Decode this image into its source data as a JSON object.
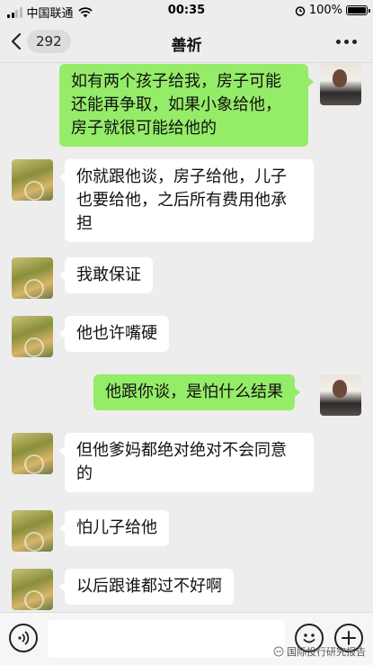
{
  "status_bar": {
    "carrier": "中国联通",
    "time": "00:35",
    "battery": "100%"
  },
  "header": {
    "unread_count": "292",
    "title": "善祈"
  },
  "messages": [
    {
      "from": "self",
      "text": "如有两个孩子给我，房子可能还能再争取，如果小象给他，房子就很可能给他的"
    },
    {
      "from": "other",
      "text": "你就跟他谈，房子给他，儿子也要给他，之后所有费用他承担"
    },
    {
      "from": "other",
      "text": "我敢保证"
    },
    {
      "from": "other",
      "text": "他也许嘴硬"
    },
    {
      "from": "self",
      "text": "他跟你谈，是怕什么结果"
    },
    {
      "from": "other",
      "text": "但他爹妈都绝对绝对不会同意的"
    },
    {
      "from": "other",
      "text": "怕儿子给他"
    },
    {
      "from": "other",
      "text": "以后跟谁都过不好啊"
    }
  ],
  "watermark": "国际投行研究报告",
  "colors": {
    "self_bubble": "#95ec69",
    "other_bubble": "#ffffff",
    "background": "#ededed"
  }
}
